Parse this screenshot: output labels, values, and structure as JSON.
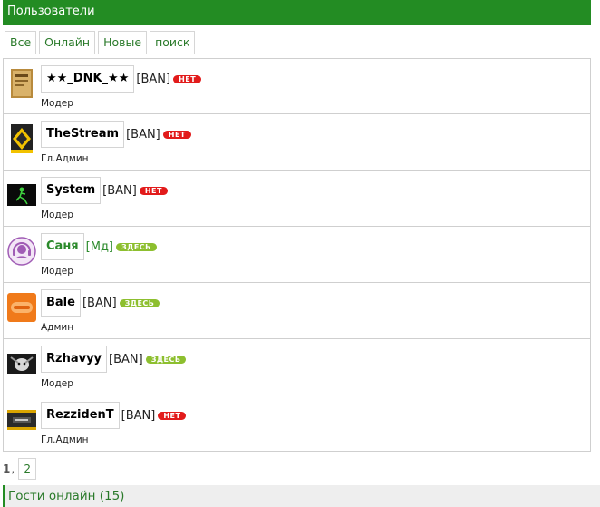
{
  "header": {
    "title": "Пользователи"
  },
  "tabs": [
    {
      "label": "Все"
    },
    {
      "label": "Онлайн"
    },
    {
      "label": "Новые"
    },
    {
      "label": "поиск"
    }
  ],
  "users": [
    {
      "name": "★★_DNK_★★",
      "tag": "[BAN]",
      "status": "НЕТ",
      "role": "Модер"
    },
    {
      "name": "TheStream",
      "tag": "[BAN]",
      "status": "НЕТ",
      "role": "Гл.Админ"
    },
    {
      "name": "System",
      "tag": "[BAN]",
      "status": "НЕТ",
      "role": "Модер"
    },
    {
      "name": "Саня",
      "tag": "[Мд]",
      "status": "ЗДЕСЬ",
      "role": "Модер"
    },
    {
      "name": "Bale",
      "tag": "[BAN]",
      "status": "ЗДЕСЬ",
      "role": "Админ"
    },
    {
      "name": "Rzhavyy",
      "tag": "[BAN]",
      "status": "ЗДЕСЬ",
      "role": "Модер"
    },
    {
      "name": "RezzidenT",
      "tag": "[BAN]",
      "status": "НЕТ",
      "role": "Гл.Админ"
    }
  ],
  "pager": {
    "current": "1",
    "separator": ",",
    "next": "2"
  },
  "guests": {
    "label": "Гости онлайн (15)"
  },
  "colors": {
    "header": "#238c23",
    "offline": "#e21b1b",
    "online": "#8dbf2f"
  }
}
